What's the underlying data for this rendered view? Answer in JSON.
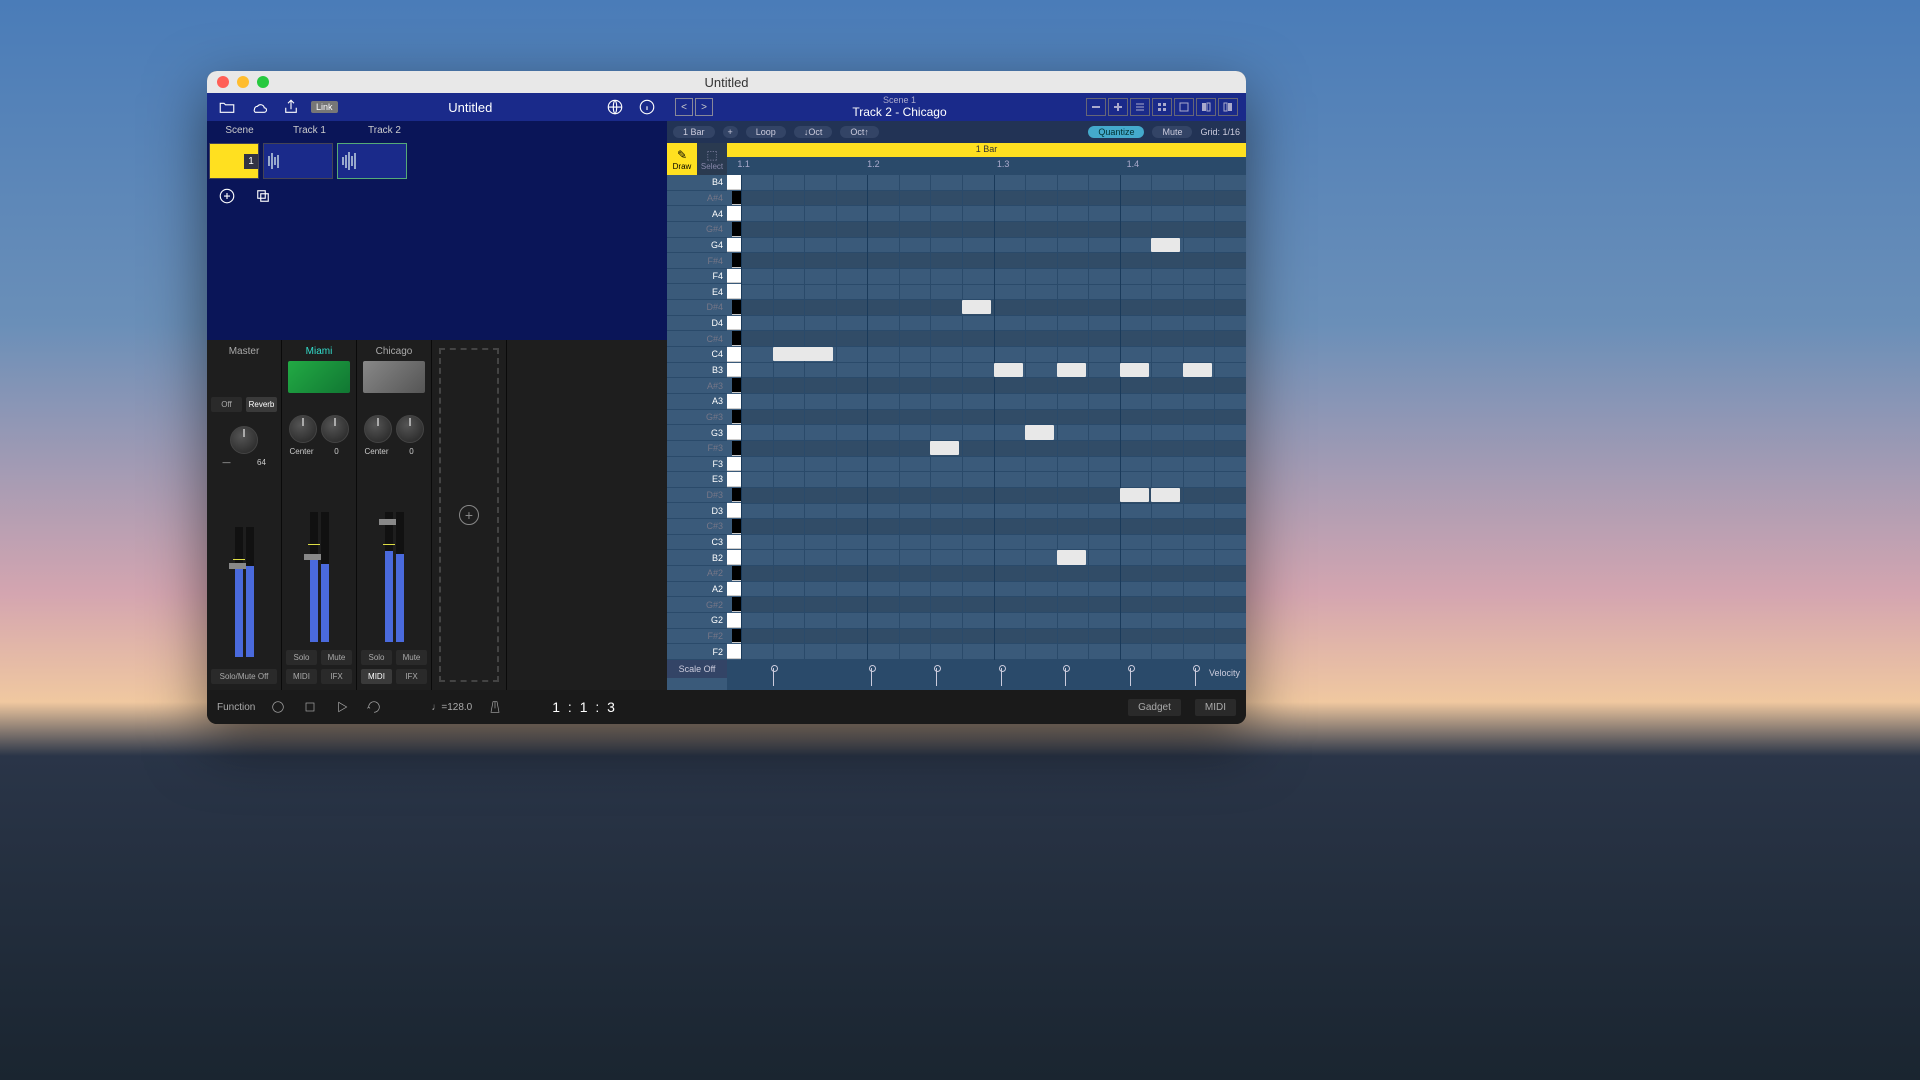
{
  "window": {
    "title": "Untitled"
  },
  "leftHeader": {
    "title": "Untitled",
    "linkBadge": "Link"
  },
  "tracks": {
    "headers": [
      "Scene",
      "Track 1",
      "Track 2"
    ],
    "sceneNumber": "1"
  },
  "mixer": {
    "master": {
      "name": "Master",
      "offLabel": "Off",
      "reverbLabel": "Reverb",
      "panDash": "—",
      "panVal": "64",
      "soloMute": "Solo/Mute Off"
    },
    "tracks": [
      {
        "name": "Miami",
        "pan": "Center",
        "send": "0",
        "solo": "Solo",
        "mute": "Mute",
        "midi": "MIDI",
        "ifx": "IFX"
      },
      {
        "name": "Chicago",
        "pan": "Center",
        "send": "0",
        "solo": "Solo",
        "mute": "Mute",
        "midi": "MIDI",
        "ifx": "IFX"
      }
    ]
  },
  "rightHeader": {
    "scene": "Scene 1",
    "track": "Track 2 - Chicago"
  },
  "toolbar": {
    "bars": "1 Bar",
    "plus": "+",
    "loop": "Loop",
    "octDown": "↓Oct",
    "octUp": "Oct↑",
    "quantize": "Quantize",
    "mute": "Mute",
    "grid": "Grid: 1/16"
  },
  "pianoRoll": {
    "drawLabel": "Draw",
    "selectLabel": "Select",
    "rulerLabel": "1 Bar",
    "beats": [
      "1.1",
      "1.2",
      "1.3",
      "1.4"
    ],
    "keys": [
      "B4",
      "A#4",
      "A4",
      "G#4",
      "G4",
      "F#4",
      "F4",
      "E4",
      "D#4",
      "D4",
      "C#4",
      "C4",
      "B3",
      "A#3",
      "A3",
      "G#3",
      "G3",
      "F#3",
      "F3",
      "E3",
      "D#3",
      "D3",
      "C#3",
      "C3",
      "B2",
      "A#2",
      "A2",
      "G#2",
      "G2",
      "F#2",
      "F2"
    ],
    "blackKeys": [
      "A#4",
      "G#4",
      "F#4",
      "D#4",
      "C#4",
      "A#3",
      "G#3",
      "F#3",
      "D#3",
      "C#3",
      "A#2",
      "G#2",
      "F#2"
    ],
    "notes": [
      {
        "row": 4,
        "col": 13,
        "len": 1
      },
      {
        "row": 8,
        "col": 7,
        "len": 1
      },
      {
        "row": 11,
        "col": 1,
        "len": 2
      },
      {
        "row": 12,
        "col": 8,
        "len": 1
      },
      {
        "row": 12,
        "col": 10,
        "len": 1
      },
      {
        "row": 12,
        "col": 12,
        "len": 1
      },
      {
        "row": 12,
        "col": 14,
        "len": 1
      },
      {
        "row": 16,
        "col": 9,
        "len": 1
      },
      {
        "row": 17,
        "col": 6,
        "len": 1
      },
      {
        "row": 20,
        "col": 12,
        "len": 1
      },
      {
        "row": 20,
        "col": 13,
        "len": 1
      },
      {
        "row": 24,
        "col": 10,
        "len": 1
      }
    ],
    "scaleOff": "Scale Off",
    "velocity": "Velocity",
    "velStems": [
      1,
      4,
      6,
      8,
      10,
      12,
      14
    ]
  },
  "transport": {
    "function": "Function",
    "tempo": "♩=128.0",
    "position": "1 :  1 :  3",
    "gadget": "Gadget",
    "midi": "MIDI"
  }
}
